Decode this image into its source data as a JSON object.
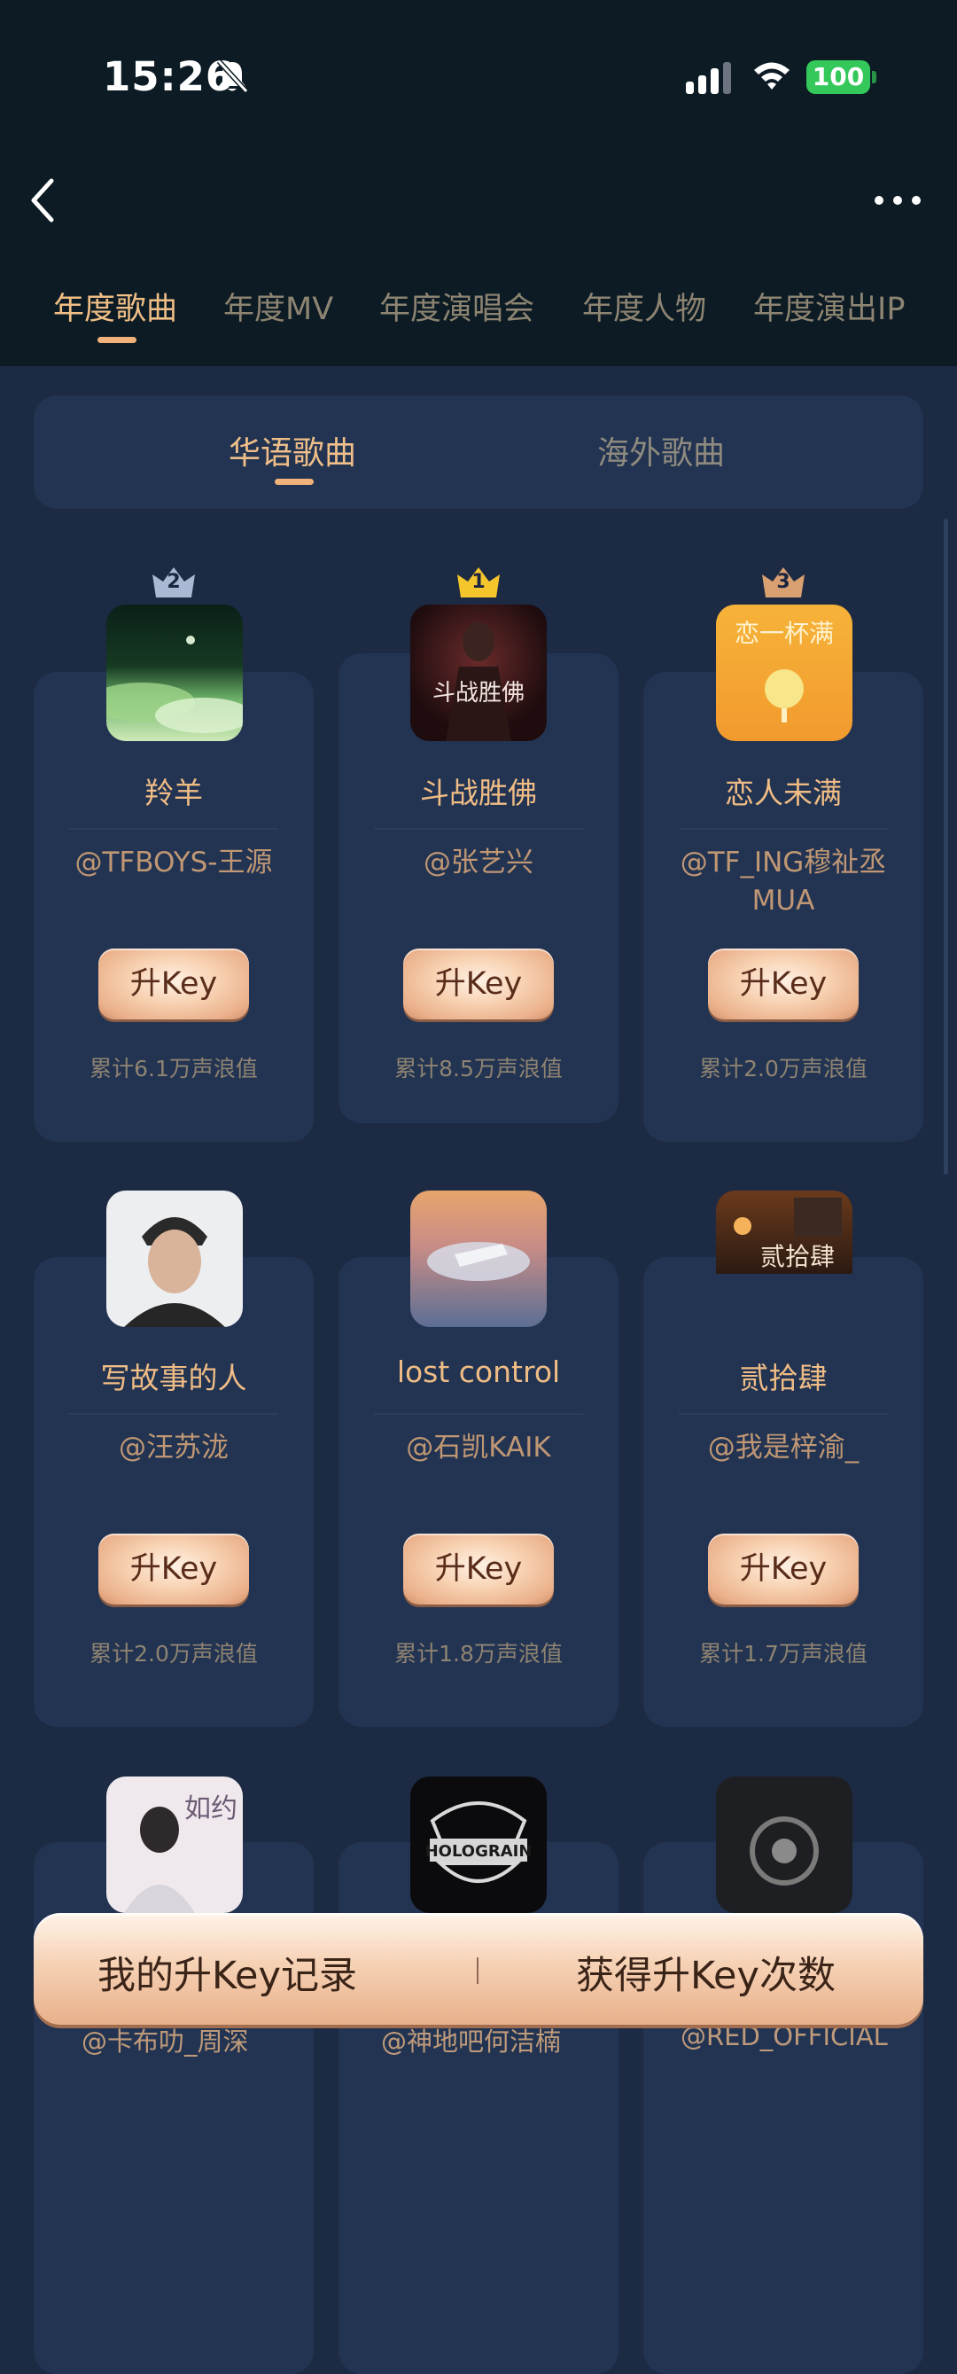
{
  "status_bar": {
    "time": "15:26",
    "battery": "100"
  },
  "tabs": [
    {
      "label": "年度歌曲",
      "active": true
    },
    {
      "label": "年度MV",
      "active": false
    },
    {
      "label": "年度演唱会",
      "active": false
    },
    {
      "label": "年度人物",
      "active": false
    },
    {
      "label": "年度演出IP",
      "active": false
    }
  ],
  "subtabs": [
    {
      "label": "华语歌曲",
      "active": true
    },
    {
      "label": "海外歌曲",
      "active": false
    }
  ],
  "button_label": "升Key",
  "songs": [
    {
      "rank": "2",
      "title": "羚羊",
      "artist": "@TFBOYS-王源",
      "stat": "累计6.1万声浪值"
    },
    {
      "rank": "1",
      "title": "斗战胜佛",
      "artist": "@张艺兴",
      "stat": "累计8.5万声浪值"
    },
    {
      "rank": "3",
      "title": "恋人未满",
      "artist": "@TF_ING穆祉丞MUA",
      "stat": "累计2.0万声浪值"
    },
    {
      "rank": "",
      "title": "写故事的人",
      "artist": "@汪苏泷",
      "stat": "累计2.0万声浪值"
    },
    {
      "rank": "",
      "title": "lost control",
      "artist": "@石凯KAIK",
      "stat": "累计1.8万声浪值"
    },
    {
      "rank": "",
      "title": "贰拾肆",
      "artist": "@我是梓渝_",
      "stat": "累计1.7万声浪值"
    },
    {
      "rank": "",
      "title": "",
      "artist": "@卡布叻_周深",
      "stat": ""
    },
    {
      "rank": "",
      "title": "",
      "artist": "@神地吧何洁楠",
      "stat": ""
    },
    {
      "rank": "",
      "title": "",
      "artist": "@RED_OFFICIAL",
      "stat": ""
    }
  ],
  "cover_text": {
    "song2": "斗战胜佛",
    "song3": "恋一杯满",
    "song6": "贰拾肆",
    "song7": "如约",
    "song8": "HOLOGRAIN"
  },
  "bottom_bar": {
    "left": "我的升Key记录",
    "right": "获得升Key次数"
  },
  "colors": {
    "accent": "#f0b27a",
    "background": "#1c2a43",
    "card": "#223452",
    "header": "#0c1b24"
  },
  "icons": [
    "bell-slash-icon",
    "signal-icon",
    "wifi-icon",
    "chevron-left-icon",
    "more-dots-icon",
    "crown-icon"
  ]
}
